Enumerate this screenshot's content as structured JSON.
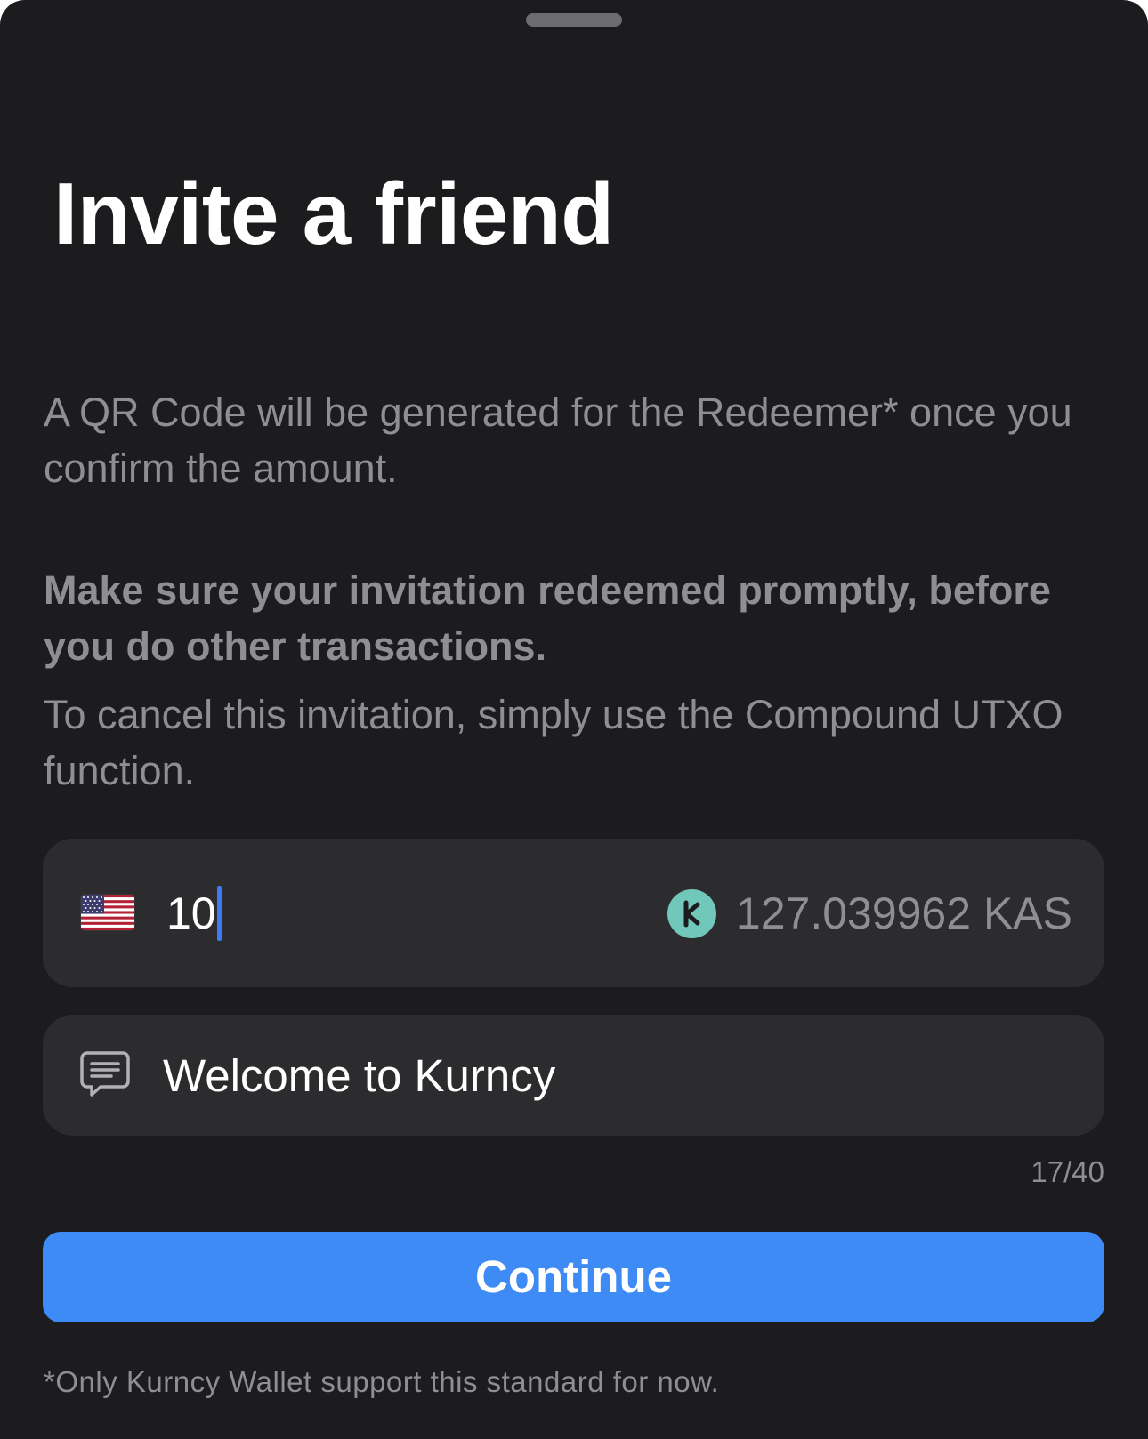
{
  "sheet": {
    "title": "Invite a friend"
  },
  "description": {
    "paragraph_1": "A QR Code will be generated for the Redeemer* once you confirm the amount.",
    "warning_bold": "Make sure your invitation redeemed promptly, before you do other transactions.",
    "paragraph_3": "To cancel this invitation, simply use the Compound UTXO function."
  },
  "amount_field": {
    "currency_icon": "us-flag-icon",
    "value": "10",
    "token_icon": "kaspa-icon",
    "converted_value": "127.039962 KAS"
  },
  "message_field": {
    "icon": "chat-bubble-icon",
    "value": "Welcome to Kurncy",
    "char_count": "17/40"
  },
  "actions": {
    "continue_label": "Continue"
  },
  "footnote": "*Only Kurncy Wallet support this standard for now.",
  "colors": {
    "background": "#1c1c1e",
    "field_background": "#2c2c2e",
    "primary_text": "#ffffff",
    "secondary_text": "#8e8e93",
    "accent": "#3f8bf5",
    "caret": "#3d7bf6",
    "kaspa_teal": "#70c7ba"
  }
}
